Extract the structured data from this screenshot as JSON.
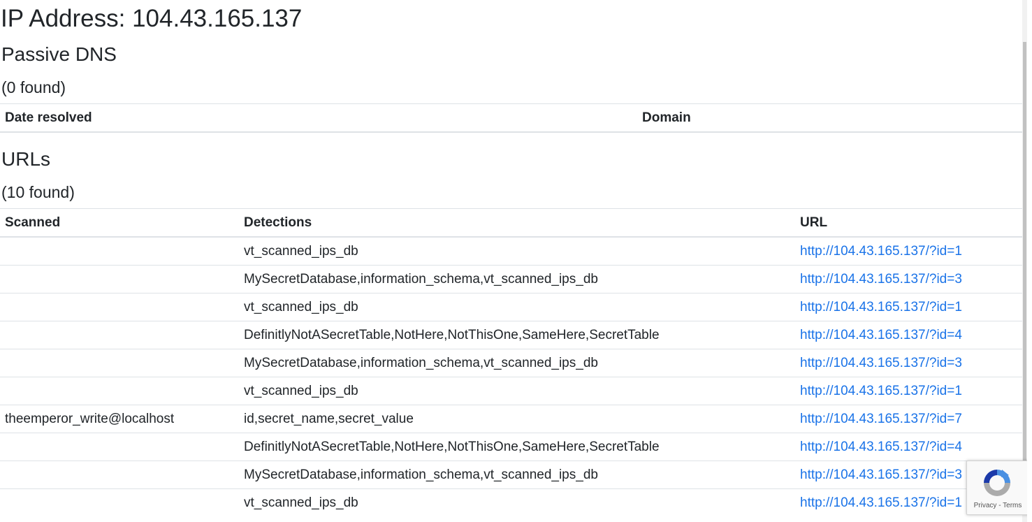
{
  "ip_heading": "IP Address: 104.43.165.137",
  "passive_dns": {
    "title": "Passive DNS",
    "count": "(0 found)",
    "columns": [
      "Date resolved",
      "Domain"
    ]
  },
  "urls": {
    "title": "URLs",
    "count": "(10 found)",
    "columns": [
      "Scanned",
      "Detections",
      "URL"
    ],
    "rows": [
      {
        "scanned": "",
        "detections": "vt_scanned_ips_db",
        "url": "http://104.43.165.137/?id=1"
      },
      {
        "scanned": "",
        "detections": "MySecretDatabase,information_schema,vt_scanned_ips_db",
        "url": "http://104.43.165.137/?id=3"
      },
      {
        "scanned": "",
        "detections": "vt_scanned_ips_db",
        "url": "http://104.43.165.137/?id=1"
      },
      {
        "scanned": "",
        "detections": "DefinitlyNotASecretTable,NotHere,NotThisOne,SameHere,SecretTable",
        "url": "http://104.43.165.137/?id=4"
      },
      {
        "scanned": "",
        "detections": "MySecretDatabase,information_schema,vt_scanned_ips_db",
        "url": "http://104.43.165.137/?id=3"
      },
      {
        "scanned": "",
        "detections": "vt_scanned_ips_db",
        "url": "http://104.43.165.137/?id=1"
      },
      {
        "scanned": "theemperor_write@localhost",
        "detections": "id,secret_name,secret_value",
        "url": "http://104.43.165.137/?id=7"
      },
      {
        "scanned": "",
        "detections": "DefinitlyNotASecretTable,NotHere,NotThisOne,SameHere,SecretTable",
        "url": "http://104.43.165.137/?id=4"
      },
      {
        "scanned": "",
        "detections": "MySecretDatabase,information_schema,vt_scanned_ips_db",
        "url": "http://104.43.165.137/?id=3"
      },
      {
        "scanned": "",
        "detections": "vt_scanned_ips_db",
        "url": "http://104.43.165.137/?id=1"
      }
    ]
  },
  "recaptcha": {
    "links": "Privacy - Terms",
    "icon": "recaptcha-logo-icon"
  },
  "colors": {
    "link": "#1a73e8",
    "text": "#212529",
    "border": "#dee2e6"
  }
}
